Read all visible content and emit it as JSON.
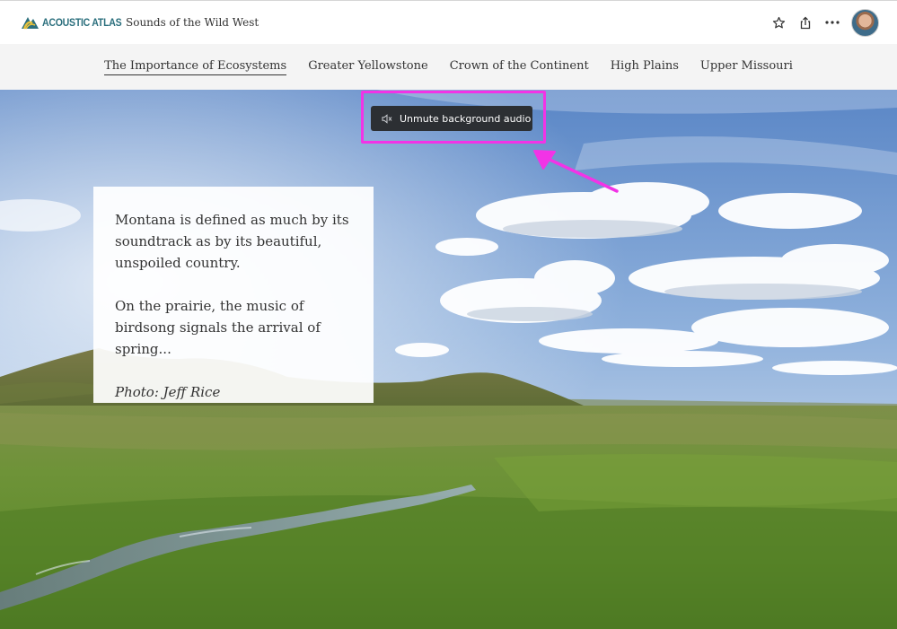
{
  "header": {
    "brand": "ACOUSTIC ATLAS",
    "story_title": "Sounds of the Wild West",
    "icons": [
      "star-icon",
      "share-icon",
      "more-icon"
    ]
  },
  "nav": {
    "items": [
      {
        "label": "The Importance of Ecosystems",
        "active": true
      },
      {
        "label": "Greater Yellowstone"
      },
      {
        "label": "Crown of the Continent"
      },
      {
        "label": "High Plains"
      },
      {
        "label": "Upper Missouri"
      }
    ]
  },
  "audio": {
    "label": "Unmute background audio",
    "icon": "speaker-muted-icon"
  },
  "card": {
    "paragraph1": "Montana is defined as much by its soundtrack as by its beautiful, unspoiled country.",
    "paragraph2": "On the prairie, the music of birdsong signals the arrival of spring...",
    "credit": "Photo: Jeff Rice"
  },
  "colors": {
    "annotation": "#f233e6",
    "brand": "#2b6f7d",
    "button_bg": "#2c2f33"
  }
}
